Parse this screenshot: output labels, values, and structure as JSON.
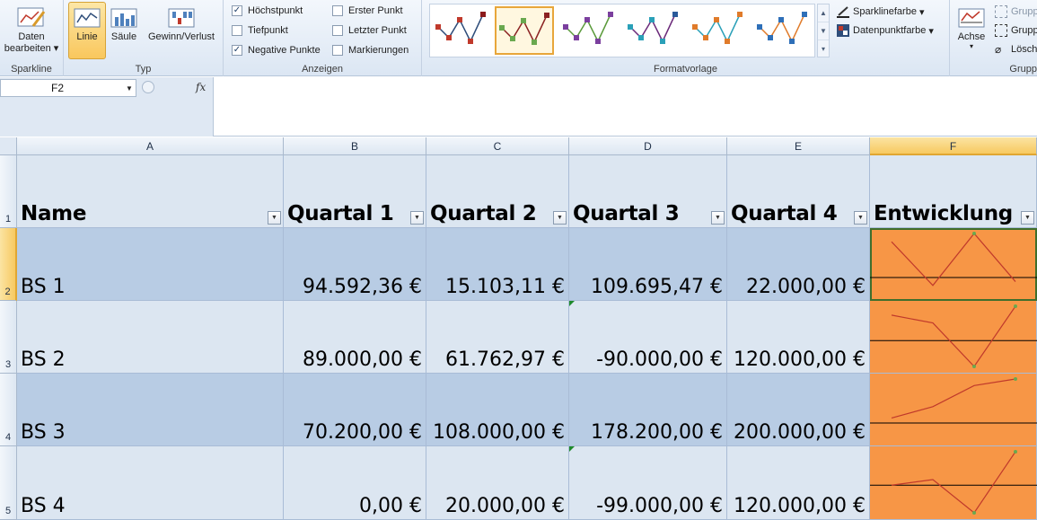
{
  "ribbon": {
    "groups": {
      "sparkline": "Sparkline",
      "typ": "Typ",
      "anzeigen": "Anzeigen",
      "formatvorlage": "Formatvorlage",
      "gruppe": "Grupp"
    },
    "buttons": {
      "daten_line1": "Daten",
      "daten_line2": "bearbeiten",
      "linie": "Linie",
      "saeule": "Säule",
      "gewinn": "Gewinn/Verlust",
      "achse": "Achse",
      "sparklinefarbe": "Sparklinefarbe",
      "datenpunktfarbe": "Datenpunktfarbe",
      "gruppieren1": "Grupp",
      "gruppieren2": "Grupp",
      "loeschen": "Lösch"
    },
    "checkboxes": [
      {
        "label": "Höchstpunkt",
        "checked": true
      },
      {
        "label": "Tiefpunkt",
        "checked": false
      },
      {
        "label": "Negative Punkte",
        "checked": true
      },
      {
        "label": "Erster Punkt",
        "checked": false
      },
      {
        "label": "Letzter Punkt",
        "checked": false
      },
      {
        "label": "Markierungen",
        "checked": false
      }
    ],
    "styles": [
      {
        "line": "#2e4d7a",
        "point": "#c0392b",
        "high": "#8b1a1a"
      },
      {
        "line": "#8b2222",
        "point": "#6aa84f",
        "high": "#8b2222"
      },
      {
        "line": "#5a9a3a",
        "point": "#7b3f9e",
        "high": "#7b3f9e"
      },
      {
        "line": "#6b2a7a",
        "point": "#2aa0b8",
        "high": "#2a5a9a"
      },
      {
        "line": "#2aa0b8",
        "point": "#e07b2a",
        "high": "#e07b2a"
      },
      {
        "line": "#e07b2a",
        "point": "#2e6fb8",
        "high": "#2e6fb8"
      }
    ]
  },
  "formula": {
    "namebox": "F2",
    "fx": "fx",
    "content": ""
  },
  "columns": [
    "A",
    "B",
    "C",
    "D",
    "E",
    "F"
  ],
  "rows": [
    "1",
    "2",
    "3",
    "4",
    "5"
  ],
  "table": {
    "headers": [
      "Name",
      "Quartal 1",
      "Quartal 2",
      "Quartal 3",
      "Quartal 4",
      "Entwicklung"
    ],
    "rows": [
      {
        "name": "BS 1",
        "values": [
          "94.592,36 €",
          "15.103,11 €",
          "109.695,47 €",
          "22.000,00 €"
        ],
        "raw": [
          94592.36,
          15103.11,
          109695.47,
          22000
        ]
      },
      {
        "name": "BS 2",
        "values": [
          "89.000,00 €",
          "61.762,97 €",
          "-90.000,00 €",
          "120.000,00 €"
        ],
        "raw": [
          89000,
          61762.97,
          -90000,
          120000
        ]
      },
      {
        "name": "BS 3",
        "values": [
          "70.200,00 €",
          "108.000,00 €",
          "178.200,00 €",
          "200.000,00 €"
        ],
        "raw": [
          70200,
          108000,
          178200,
          200000
        ]
      },
      {
        "name": "BS 4",
        "values": [
          "0,00 €",
          "20.000,00 €",
          "-99.000,00 €",
          "120.000,00 €"
        ],
        "raw": [
          0,
          20000,
          -99000,
          120000
        ]
      }
    ]
  },
  "colors": {
    "band_dark": "#b8cce4",
    "band_light": "#dce6f1",
    "sparkline_bg": "#f79646",
    "sparkline_line": "#c0392b",
    "sparkline_high": "#6aa84f",
    "sparkline_axis": "#000000"
  }
}
